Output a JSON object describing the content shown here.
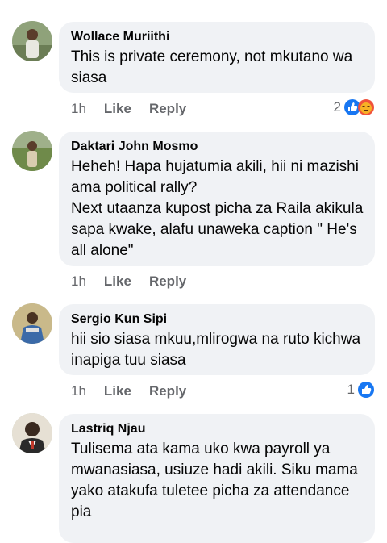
{
  "comments": [
    {
      "author": "Wollace Muriithi",
      "text": "This is private ceremony, not mkutano wa siasa",
      "time": "1h",
      "like": "Like",
      "reply": "Reply",
      "reaction_count": "2",
      "reactions": [
        "like-icon",
        "angry-icon"
      ]
    },
    {
      "author": "Daktari John Mosmo",
      "text": "Heheh! Hapa hujatumia akili, hii ni mazishi ama political rally?\nNext utaanza kupost picha za Raila akikula sapa kwake, alafu unaweka caption \" He's all alone\"",
      "time": "1h",
      "like": "Like",
      "reply": "Reply"
    },
    {
      "author": "Sergio Kun Sipi",
      "text": "hii sio siasa mkuu,mlirogwa na ruto kichwa inapiga tuu siasa",
      "time": "1h",
      "like": "Like",
      "reply": "Reply",
      "reaction_count": "1",
      "reactions": [
        "like-icon"
      ]
    },
    {
      "author": "Lastriq Njau",
      "text": "Tulisema ata kama uko kwa payroll ya mwanasiasa, usiuze hadi akili. Siku mama yako atakufa tuletee picha za attendance pia"
    }
  ],
  "colors": {
    "bubble": "#f0f2f5",
    "meta": "#65676b",
    "like": "#1877f2",
    "angry": "#f0523b"
  }
}
